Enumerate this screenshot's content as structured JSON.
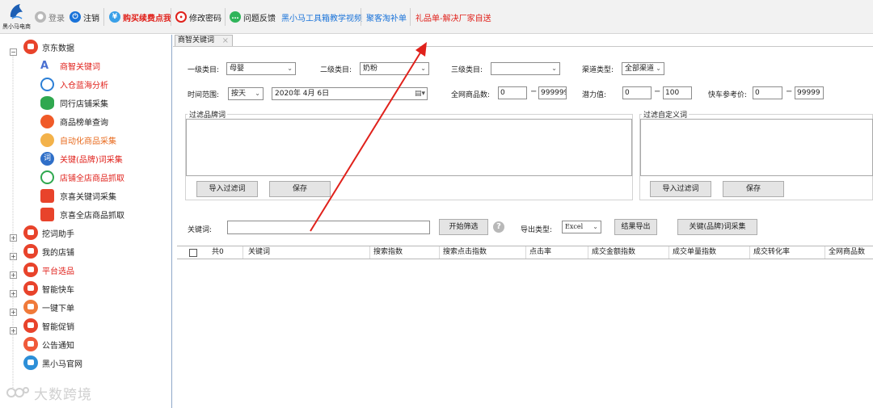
{
  "toolbar": {
    "logo_text": "黑小马电商",
    "login": "登录",
    "logout": "注销",
    "buy": "购买续费点我",
    "change_password": "修改密码",
    "feedback": "问题反馈",
    "video_link": "黑小马工具箱教学视频",
    "taobao_link": "聚客淘补单",
    "gift_link": "礼品单-解决厂家自送"
  },
  "sidebar": {
    "root": {
      "label": "京东数据",
      "expander": "−"
    },
    "children": [
      {
        "label": "商智关键词",
        "color": "red"
      },
      {
        "label": "入仓蓝海分析",
        "color": "red"
      },
      {
        "label": "同行店铺采集",
        "color": "normal"
      },
      {
        "label": "商品榜单查询",
        "color": "normal"
      },
      {
        "label": "自动化商品采集",
        "color": "orange"
      },
      {
        "label": "关键(品牌)词采集",
        "color": "red"
      },
      {
        "label": "店铺全店商品抓取",
        "color": "red"
      },
      {
        "label": "京喜关键词采集",
        "color": "normal"
      },
      {
        "label": "京喜全店商品抓取",
        "color": "normal"
      }
    ],
    "categories": [
      {
        "label": "挖词助手",
        "expander": "+",
        "color": "normal"
      },
      {
        "label": "我的店铺",
        "expander": "+",
        "color": "normal"
      },
      {
        "label": "平台选品",
        "expander": "+",
        "color": "red"
      },
      {
        "label": "智能快车",
        "expander": "+",
        "color": "normal"
      },
      {
        "label": "一键下单",
        "expander": "+",
        "color": "normal"
      },
      {
        "label": "智能促销",
        "expander": "+",
        "color": "normal"
      },
      {
        "label": "公告通知",
        "expander": "",
        "color": "normal"
      },
      {
        "label": "黑小马官网",
        "expander": "",
        "color": "normal"
      }
    ]
  },
  "tab": {
    "label": "商智关键词",
    "close": "×"
  },
  "form": {
    "cat1_label": "一级类目:",
    "cat1_value": "母婴",
    "cat2_label": "二级类目:",
    "cat2_value": "奶粉",
    "cat3_label": "三级类目:",
    "cat3_value": "",
    "channel_label": "渠道类型:",
    "channel_value": "全部渠道",
    "time_label": "时间范围:",
    "time_value": "按天",
    "date_value": "2020年 4月 6日",
    "total_label": "全网商品数:",
    "total_min": "0",
    "total_max": "9999999",
    "potential_label": "潜力值:",
    "potential_min": "0",
    "potential_max": "100",
    "express_label": "快车参考价:",
    "express_min": "0",
    "express_max": "99999",
    "dash": "−"
  },
  "filters": {
    "brand_title": "过滤品牌词",
    "custom_title": "过滤自定义词",
    "import_label": "导入过滤词",
    "save_label": "保存"
  },
  "search": {
    "keyword_label": "关键词:",
    "keyword_value": "",
    "start_button": "开始筛选",
    "help": "?",
    "export_type_label": "导出类型:",
    "export_type_value": "Excel",
    "export_button": "结果导出",
    "collect_button": "关键(品牌)词采集"
  },
  "grid": {
    "columns": [
      "共0",
      "关键词",
      "搜索指数",
      "搜索点击指数",
      "点击率",
      "成交金额指数",
      "成交单量指数",
      "成交转化率",
      "全网商品数"
    ]
  },
  "watermark": {
    "text": "大数跨境"
  },
  "colors": {
    "red": "#e0211b",
    "link": "#1a73d9",
    "orange": "#e86b1f",
    "arrow": "#e0211b"
  }
}
